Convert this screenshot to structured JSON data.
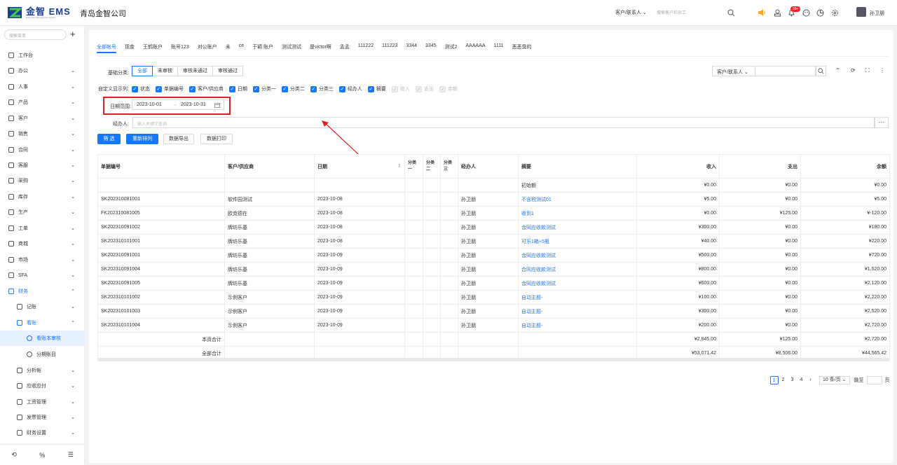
{
  "header": {
    "logo_text": "金智 EMS",
    "logo_sub": "Enterprise Management System",
    "company": "青岛金智公司",
    "search_scope": "客户/联系人",
    "search_placeholder": "搜索客户和员工",
    "notification_badge": "99+",
    "user_name": "孙卫朋"
  },
  "sidebar": {
    "search_placeholder": "搜索菜单",
    "items": [
      {
        "label": "工作台",
        "icon": "dashboard-icon"
      },
      {
        "label": "办公",
        "icon": "office-icon"
      },
      {
        "label": "人事",
        "icon": "person-icon"
      },
      {
        "label": "产品",
        "icon": "product-icon"
      },
      {
        "label": "客户",
        "icon": "customer-icon"
      },
      {
        "label": "销售",
        "icon": "sales-icon"
      },
      {
        "label": "合同",
        "icon": "contract-icon"
      },
      {
        "label": "客服",
        "icon": "service-icon"
      },
      {
        "label": "采购",
        "icon": "purchase-icon"
      },
      {
        "label": "库存",
        "icon": "inventory-icon"
      },
      {
        "label": "生产",
        "icon": "production-icon"
      },
      {
        "label": "工单",
        "icon": "workorder-icon"
      },
      {
        "label": "商城",
        "icon": "mall-icon"
      },
      {
        "label": "市场",
        "icon": "market-icon"
      },
      {
        "label": "SFA",
        "icon": "sfa-icon"
      },
      {
        "label": "财务",
        "icon": "finance-icon"
      },
      {
        "label": "记账",
        "icon": "bookkeeping-icon"
      },
      {
        "label": "看账",
        "icon": "viewbook-icon"
      },
      {
        "label": "看账本审核",
        "icon": "audit-icon"
      },
      {
        "label": "分期账目",
        "icon": "installment-icon"
      },
      {
        "label": "分析帐",
        "icon": "analysis-icon"
      },
      {
        "label": "应收应付",
        "icon": "receivable-icon"
      },
      {
        "label": "工资管理",
        "icon": "salary-icon"
      },
      {
        "label": "发票管理",
        "icon": "invoice-icon"
      },
      {
        "label": "财务设置",
        "icon": "finance-settings-icon"
      }
    ],
    "bottom": [
      "⟲",
      "%",
      "☰"
    ]
  },
  "tabs": [
    "全部帐号",
    "现金",
    "王鹤账户",
    "账号123",
    "对公账户",
    "未",
    "ce",
    "于颖 账户",
    "测试测试",
    "是victor啊",
    "孟孟",
    "111222",
    "111223",
    "3344",
    "3345",
    "测试2",
    "AAAAAA",
    "1111",
    "恶恶臭的"
  ],
  "filters": {
    "basic_label": "基础分类:",
    "segments": [
      "全部",
      "未审核",
      "审核未通过",
      "审核通过"
    ],
    "right_select": "客户/联系人",
    "columns_label": "自定义显示列:",
    "columns": [
      {
        "label": "状态",
        "checked": true
      },
      {
        "label": "单据编号",
        "checked": true
      },
      {
        "label": "客户/供应商",
        "checked": true
      },
      {
        "label": "日期",
        "checked": true
      },
      {
        "label": "分类一",
        "checked": true
      },
      {
        "label": "分类二",
        "checked": true
      },
      {
        "label": "分类三",
        "checked": true
      },
      {
        "label": "经办人",
        "checked": true
      },
      {
        "label": "摘要",
        "checked": true
      },
      {
        "label": "收入",
        "checked": false
      },
      {
        "label": "支出",
        "checked": false
      },
      {
        "label": "余额",
        "checked": false
      }
    ],
    "date_label": "日期范围:",
    "date_start": "2023-10-01",
    "date_sep": "→",
    "date_end": "2023-10-31",
    "operator_label": "经办人:",
    "operator_placeholder": "输入关键字查询",
    "more": "···"
  },
  "actions": [
    "筛 选",
    "重新排列",
    "数据导出",
    "数据打印"
  ],
  "table": {
    "headers": [
      "单据编号",
      "客户/供应商",
      "日期",
      "分类一",
      "分类二",
      "分类三",
      "经办人",
      "摘要",
      "收入",
      "支出",
      "余额"
    ],
    "rows": [
      [
        "",
        "",
        "",
        "",
        "",
        "",
        "",
        "初始额",
        "¥0.00",
        "¥0.00",
        "¥0.00"
      ],
      [
        "SK202310081001",
        "软件园测试",
        "2023-10-08",
        "",
        "",
        "",
        "孙卫朋",
        "不含税测试01",
        "¥5.00",
        "¥0.00",
        "¥5.00"
      ],
      [
        "FK202310081005",
        "欧克德在",
        "2023-10-08",
        "",
        "",
        "",
        "孙卫朋",
        "收到1",
        "¥0.00",
        "¥125.00",
        "¥-120.00"
      ],
      [
        "SK202310091002",
        "牌坊乐基",
        "2023-10-08",
        "",
        "",
        "",
        "孙卫朋",
        "合同应收款测试",
        "¥300.00",
        "¥0.00",
        "¥180.00"
      ],
      [
        "SK202310101001",
        "牌坊乐基",
        "2023-10-08",
        "",
        "",
        "",
        "孙卫朋",
        "可乐1箱+5瓶",
        "¥40.00",
        "¥0.00",
        "¥220.00"
      ],
      [
        "SK202310091001",
        "牌坊乐基",
        "2023-10-09",
        "",
        "",
        "",
        "孙卫朋",
        "合同应收款测试",
        "¥500.00",
        "¥0.00",
        "¥720.00"
      ],
      [
        "SK202310091004",
        "牌坊乐基",
        "2023-10-09",
        "",
        "",
        "",
        "孙卫朋",
        "合同应收款测试",
        "¥800.00",
        "¥0.00",
        "¥1,520.00"
      ],
      [
        "SK202310091005",
        "牌坊乐基",
        "2023-10-09",
        "",
        "",
        "",
        "孙卫朋",
        "合同应收款测试",
        "¥600.00",
        "¥0.00",
        "¥2,120.00"
      ],
      [
        "SK202310101002",
        "示例客户",
        "2023-10-09",
        "",
        "",
        "",
        "孙卫朋",
        "自动主题-",
        "¥100.00",
        "¥0.00",
        "¥2,220.00"
      ],
      [
        "SK202310101003",
        "示例客户",
        "2023-10-09",
        "",
        "",
        "",
        "孙卫朋",
        "自动主题-",
        "¥300.00",
        "¥0.00",
        "¥2,520.00"
      ],
      [
        "SK202310101004",
        "示例客户",
        "2023-10-09",
        "",
        "",
        "",
        "孙卫朋",
        "自动主题-",
        "¥200.00",
        "¥0.00",
        "¥2,720.00"
      ]
    ],
    "page_total": {
      "label": "本页合计",
      "income": "¥2,845.00",
      "expense": "¥125.00",
      "balance": "¥2,720.00"
    },
    "all_total": {
      "label": "全部合计",
      "income": "¥53,071.42",
      "expense": "¥8,506.00",
      "balance": "¥44,565.42"
    }
  },
  "pager": {
    "prev": "‹",
    "pages": [
      "1",
      "2",
      "3",
      "4"
    ],
    "current": "1",
    "next": "›",
    "page_size": "10 条/页",
    "jump_label": "跳至",
    "page_unit": "页"
  }
}
